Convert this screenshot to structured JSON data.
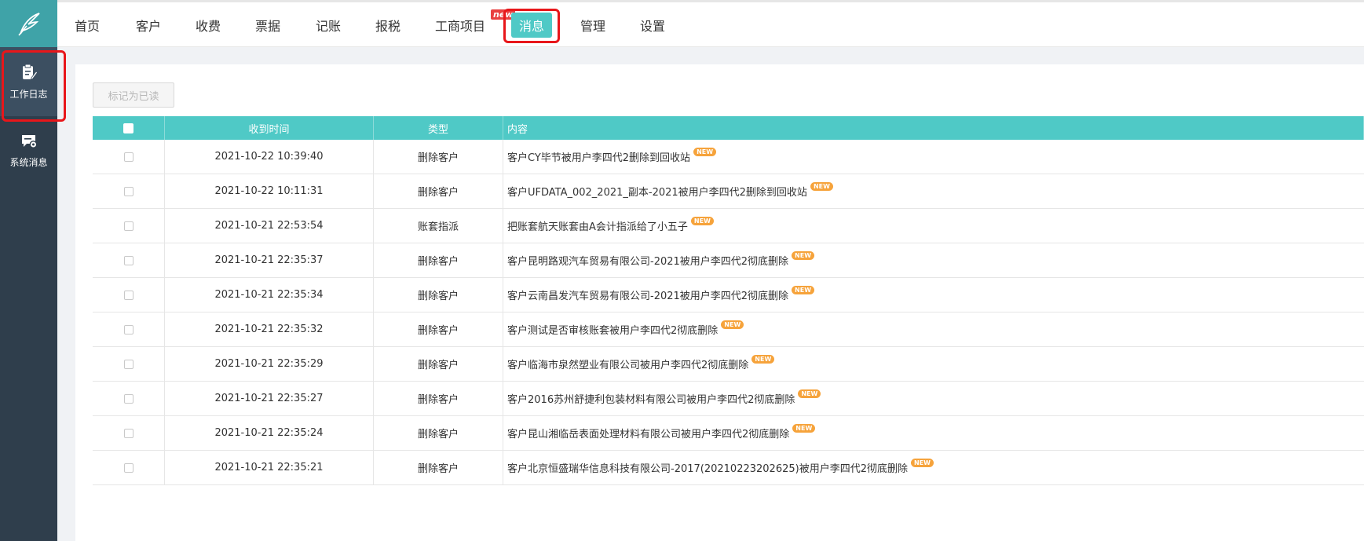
{
  "sidebar": {
    "logo_icon": "feather-logo-icon",
    "items": [
      {
        "label": "工作日志",
        "icon": "clipboard-edit-icon",
        "active": true
      },
      {
        "label": "系统消息",
        "icon": "message-gear-icon",
        "active": false
      }
    ]
  },
  "nav": {
    "items": [
      {
        "label": "首页"
      },
      {
        "label": "客户"
      },
      {
        "label": "收费"
      },
      {
        "label": "票据"
      },
      {
        "label": "记账"
      },
      {
        "label": "报税"
      },
      {
        "label": "工商项目",
        "badge": "new"
      },
      {
        "label": "消息",
        "active": true
      },
      {
        "label": "管理"
      },
      {
        "label": "设置"
      }
    ]
  },
  "toolbar": {
    "mark_read_label": "标记为已读"
  },
  "table": {
    "headers": {
      "time": "收到时间",
      "type": "类型",
      "content": "内容"
    },
    "new_tag": "NEW",
    "rows": [
      {
        "time": "2021-10-22 10:39:40",
        "type": "删除客户",
        "content": "客户CY毕节被用户李四代2删除到回收站"
      },
      {
        "time": "2021-10-22 10:11:31",
        "type": "删除客户",
        "content": "客户UFDATA_002_2021_副本-2021被用户李四代2删除到回收站"
      },
      {
        "time": "2021-10-21 22:53:54",
        "type": "账套指派",
        "content": "把账套航天账套由A会计指派给了小五子"
      },
      {
        "time": "2021-10-21 22:35:37",
        "type": "删除客户",
        "content": "客户昆明路观汽车贸易有限公司-2021被用户李四代2彻底删除"
      },
      {
        "time": "2021-10-21 22:35:34",
        "type": "删除客户",
        "content": "客户云南昌发汽车贸易有限公司-2021被用户李四代2彻底删除"
      },
      {
        "time": "2021-10-21 22:35:32",
        "type": "删除客户",
        "content": "客户测试是否审核账套被用户李四代2彻底删除"
      },
      {
        "time": "2021-10-21 22:35:29",
        "type": "删除客户",
        "content": "客户临海市泉然塑业有限公司被用户李四代2彻底删除"
      },
      {
        "time": "2021-10-21 22:35:27",
        "type": "删除客户",
        "content": "客户2016苏州舒捷利包装材料有限公司被用户李四代2彻底删除"
      },
      {
        "time": "2021-10-21 22:35:24",
        "type": "删除客户",
        "content": "客户昆山湘临岳表面处理材料有限公司被用户李四代2彻底删除"
      },
      {
        "time": "2021-10-21 22:35:21",
        "type": "删除客户",
        "content": "客户北京恒盛瑞华信息科技有限公司-2017(20210223202625)被用户李四代2彻底删除"
      }
    ]
  },
  "colors": {
    "accent": "#4fc9c6",
    "sidebar": "#2f3e4c",
    "highlight": "#e8161a",
    "new_tag": "#f6a33b"
  }
}
